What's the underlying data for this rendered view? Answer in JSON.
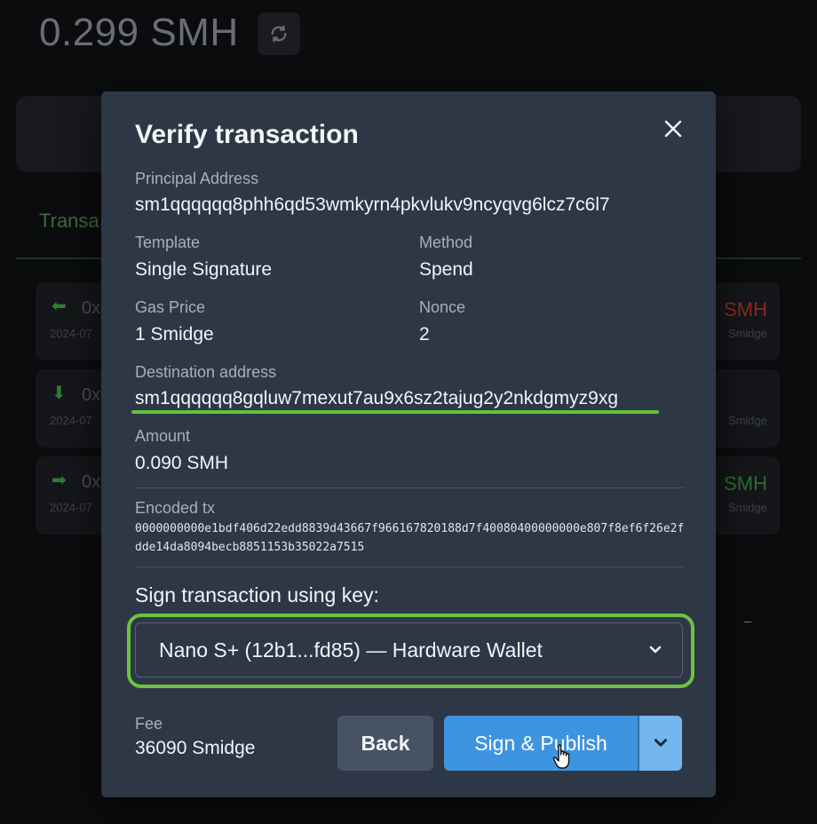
{
  "background": {
    "balance": "0.299 SMH",
    "refresh_icon": "refresh-icon",
    "tab_label": "Transa",
    "rows": [
      {
        "direction_icon": "arrow-left-icon",
        "hash": "0x",
        "date": "2024-07",
        "amount": "SMH",
        "fee": "Smidge",
        "amount_color": "#c0392b"
      },
      {
        "direction_icon": "arrow-down-icon",
        "hash": "0x",
        "date": "2024-07",
        "amount": "",
        "fee": "Smidge",
        "amount_color": "#7c8088"
      },
      {
        "direction_icon": "arrow-right-icon",
        "hash": "0x",
        "date": "2024-07",
        "amount": "SMH",
        "fee": "Smidge",
        "amount_color": "#3a9d45"
      }
    ]
  },
  "modal": {
    "title": "Verify transaction",
    "close_icon": "close-icon",
    "principal_label": "Principal Address",
    "principal_value": "sm1qqqqqq8phh6qd53wmkyrn4pkvlukv9ncyqvg6lcz7c6l7",
    "template_label": "Template",
    "template_value": "Single Signature",
    "method_label": "Method",
    "method_value": "Spend",
    "gas_price_label": "Gas Price",
    "gas_price_value": "1 Smidge",
    "nonce_label": "Nonce",
    "nonce_value": "2",
    "destination_label": "Destination address",
    "destination_value": "sm1qqqqqq8gqluw7mexut7au9x6sz2tajug2y2nkdgmyz9xg",
    "amount_label": "Amount",
    "amount_value": "0.090 SMH",
    "encoded_label": "Encoded tx",
    "encoded_value": "0000000000e1bdf406d22edd8839d43667f966167820188d7f40080400000000e807f8ef6f26e2fdde14da8094becb8851153b35022a7515",
    "sign_heading": "Sign transaction using key:",
    "selected_key": "Nano S+ (12b1...fd85) — Hardware Wallet",
    "fee_label": "Fee",
    "fee_value": "36090 Smidge",
    "back_label": "Back",
    "publish_label": "Sign & Publish"
  },
  "colors": {
    "accent_green": "#6cc43c",
    "primary_blue": "#3f94e0",
    "modal_bg": "#2d3746"
  }
}
